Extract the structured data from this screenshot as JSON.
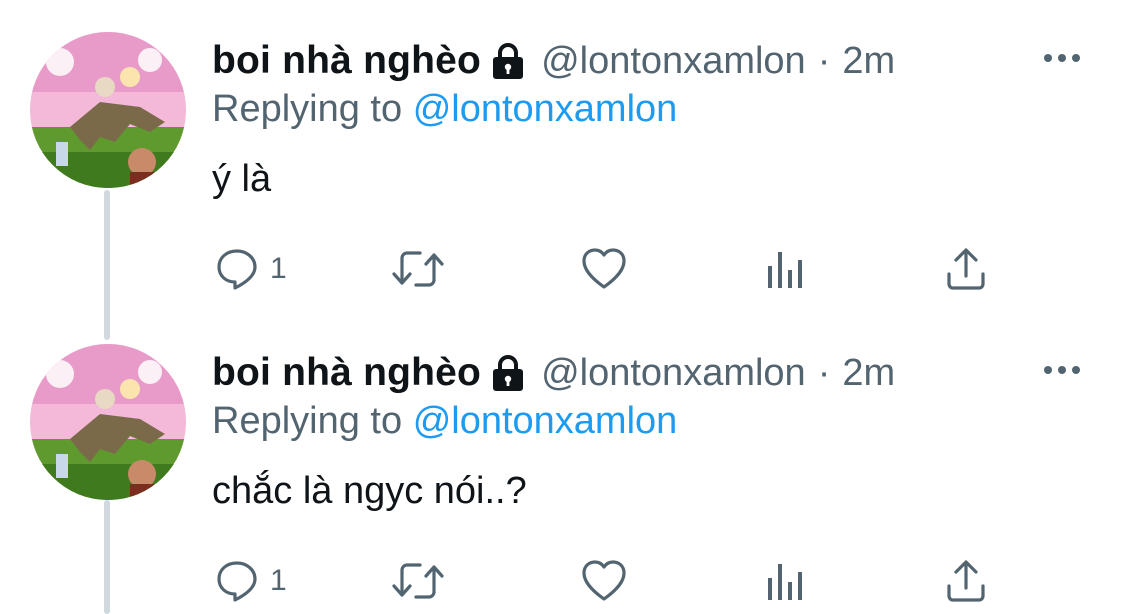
{
  "tweets": [
    {
      "display_name": "boi nhà nghèo",
      "handle": "@lontonxamlon",
      "separator": "·",
      "time": "2m",
      "replying_prefix": "Replying to",
      "replying_to": "@lontonxamlon",
      "text": "ý là",
      "reply_count": "1",
      "icons": [
        "lock-icon",
        "more-icon",
        "reply-icon",
        "retweet-icon",
        "like-icon",
        "views-icon",
        "share-icon"
      ]
    },
    {
      "display_name": "boi nhà nghèo",
      "handle": "@lontonxamlon",
      "separator": "·",
      "time": "2m",
      "replying_prefix": "Replying to",
      "replying_to": "@lontonxamlon",
      "text": "chắc là ngyc nói..?",
      "reply_count": "1",
      "icons": [
        "lock-icon",
        "more-icon",
        "reply-icon",
        "retweet-icon",
        "like-icon",
        "views-icon",
        "share-icon"
      ]
    }
  ],
  "colors": {
    "text": "#0f1419",
    "secondary": "#536471",
    "mention": "#1d9bf0",
    "thread_line": "#cfd9de"
  }
}
